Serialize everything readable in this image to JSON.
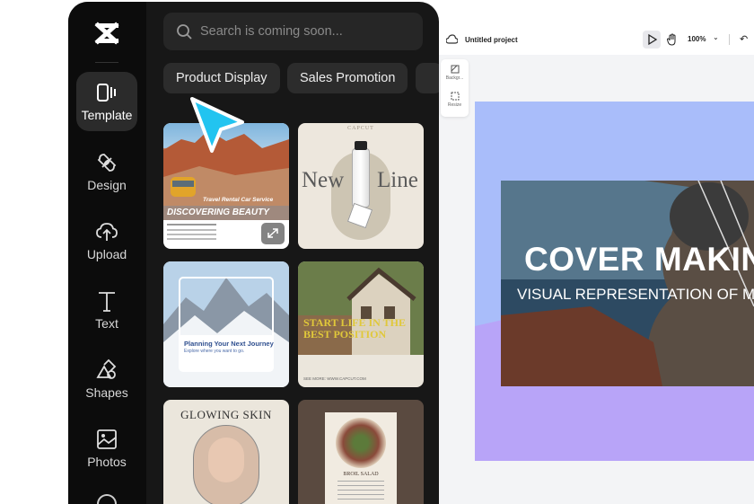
{
  "rail": {
    "logo": "capcut-logo",
    "items": [
      {
        "label": "Template",
        "icon": "template-icon",
        "active": true
      },
      {
        "label": "Design",
        "icon": "design-icon"
      },
      {
        "label": "Upload",
        "icon": "upload-cloud-icon"
      },
      {
        "label": "Text",
        "icon": "text-icon"
      },
      {
        "label": "Shapes",
        "icon": "shapes-icon"
      },
      {
        "label": "Photos",
        "icon": "photos-icon"
      }
    ]
  },
  "search": {
    "placeholder": "Search is coming soon..."
  },
  "chips": [
    "Product Display",
    "Sales Promotion"
  ],
  "templates": {
    "card1": {
      "title": "DISCOVERING BEAUTY",
      "subtitle": "Travel Rental Car Service"
    },
    "card2": {
      "brand": "CAPCUT",
      "left": "New",
      "right": "Line"
    },
    "card3": {
      "title": "Planning Your Next Journey",
      "subtitle": "Explore where you want to go."
    },
    "card4": {
      "title": "START LIFE IN THE BEST POSITION",
      "more": "SEE MORE: WWW.CAPCUT.COM"
    },
    "card5": {
      "title": "GLOWING SKIN"
    },
    "card6": {
      "title": "BROIL SALAD"
    }
  },
  "editor": {
    "project_title": "Untitled project",
    "zoom": "100%",
    "tools": [
      "Backgr...",
      "Resize"
    ],
    "canvas": {
      "heading": "COVER MAKIN",
      "subheading": "VISUAL REPRESENTATION OF M"
    },
    "colors": {
      "canvas_bg": "#a9bdfa",
      "canvas_accent": "#b8a4f8"
    }
  }
}
